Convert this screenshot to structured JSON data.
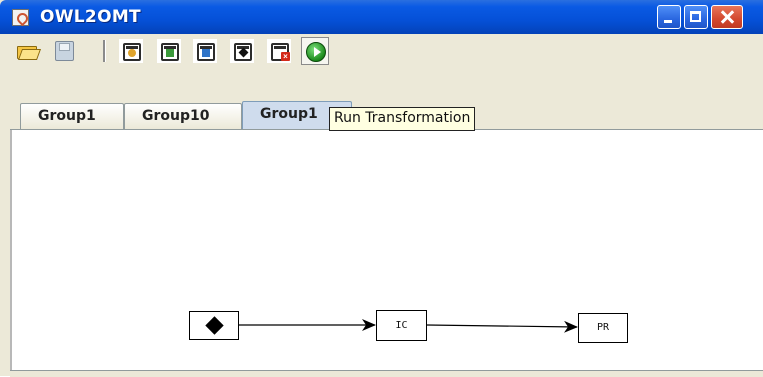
{
  "window": {
    "title": "OWL2OMT",
    "controls": [
      "minimize",
      "maximize",
      "close"
    ]
  },
  "toolbar": {
    "buttons": [
      {
        "name": "open-folder-icon",
        "tooltip": ""
      },
      {
        "name": "save-disk-icon",
        "tooltip": ""
      },
      {
        "name": "add-group-node-icon",
        "tooltip": ""
      },
      {
        "name": "add-green-node-icon",
        "tooltip": ""
      },
      {
        "name": "add-blue-node-icon",
        "tooltip": ""
      },
      {
        "name": "add-start-node-icon",
        "tooltip": ""
      },
      {
        "name": "delete-node-icon",
        "tooltip": ""
      },
      {
        "name": "run-icon",
        "tooltip": "Run Transformation"
      }
    ]
  },
  "tabs": [
    {
      "label": "Group1",
      "selected": false
    },
    {
      "label": "Group10",
      "selected": false
    },
    {
      "label": "Group1",
      "selected": true
    }
  ],
  "tooltip": {
    "text": "Run Transformation"
  },
  "diagram": {
    "nodes": [
      {
        "id": "start",
        "label": "",
        "shape": "diamond-start"
      },
      {
        "id": "ic",
        "label": "IC"
      },
      {
        "id": "pr",
        "label": "PR"
      }
    ],
    "edges": [
      {
        "from": "start",
        "to": "ic"
      },
      {
        "from": "ic",
        "to": "pr"
      }
    ]
  },
  "colors": {
    "titlebar": "#0550d7",
    "tab_selected": "#cfdced",
    "tooltip_bg": "#ffffe1",
    "close_button": "#d3482e",
    "run_button": "#1c8a1c"
  }
}
